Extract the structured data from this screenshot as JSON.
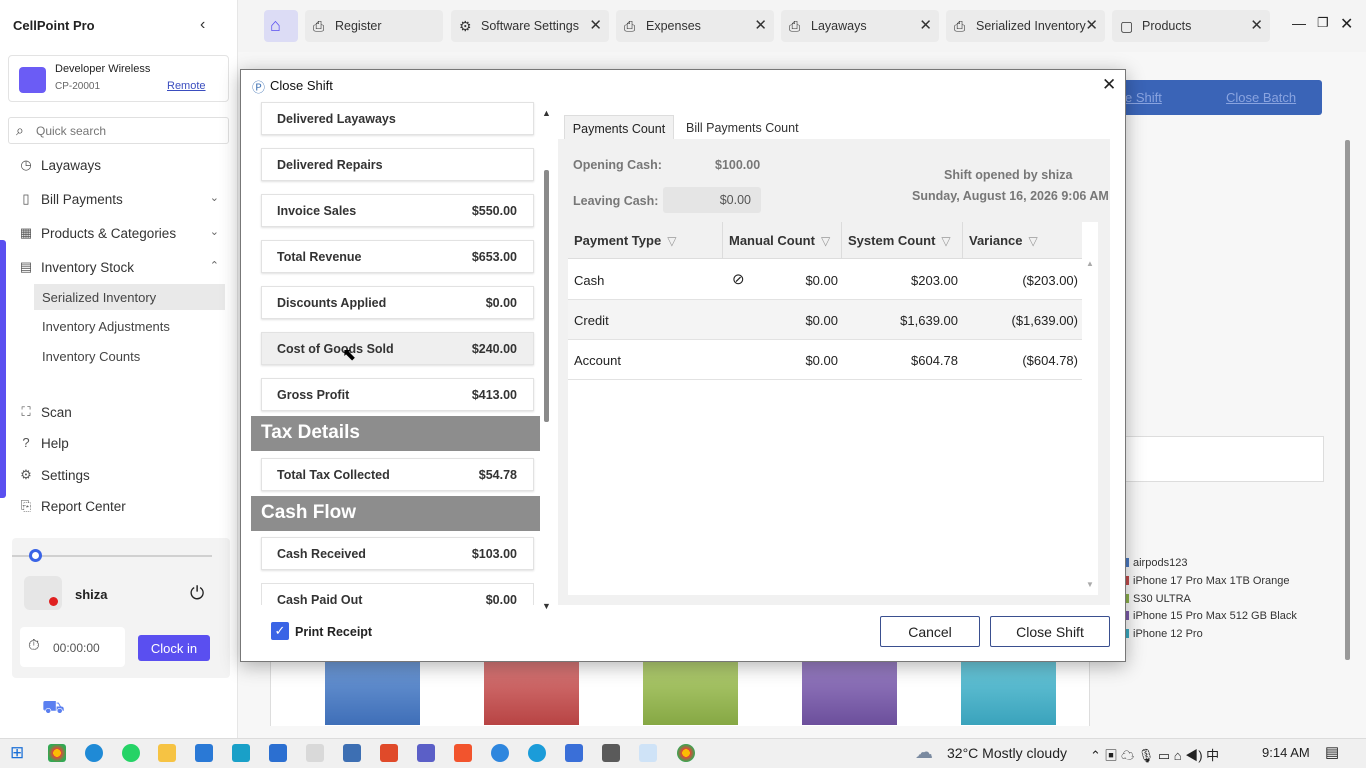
{
  "app": {
    "title": "CellPoint Pro"
  },
  "account": {
    "name": "Developer Wireless",
    "id": "CP-20001",
    "remote_label": "Remote"
  },
  "search": {
    "placeholder": "Quick search"
  },
  "sidebar": {
    "items": [
      {
        "label": "Layaways",
        "icon": "layaways-icon"
      },
      {
        "label": "Bill Payments",
        "icon": "bill-icon"
      },
      {
        "label": "Products & Categories",
        "icon": "products-icon"
      },
      {
        "label": "Inventory Stock",
        "icon": "inventory-icon"
      }
    ],
    "sub_items": [
      "Serialized Inventory",
      "Inventory Adjustments",
      "Inventory Counts"
    ],
    "bottom_items": [
      {
        "label": "Scan",
        "icon": "scan-icon"
      },
      {
        "label": "Help",
        "icon": "help-icon"
      },
      {
        "label": "Settings",
        "icon": "gear-icon"
      },
      {
        "label": "Report Center",
        "icon": "report-icon"
      }
    ]
  },
  "user": {
    "name": "shiza",
    "timer": "00:00:00",
    "clock_in_label": "Clock in"
  },
  "tabs": [
    {
      "label": "Register"
    },
    {
      "label": "Software Settings"
    },
    {
      "label": "Expenses"
    },
    {
      "label": "Layaways"
    },
    {
      "label": "Serialized Inventory"
    },
    {
      "label": "Products"
    }
  ],
  "background": {
    "links": [
      "e Shift",
      "Close Batch"
    ],
    "legend": [
      {
        "label": "airpods123",
        "color": "#4a78c0"
      },
      {
        "label": "iPhone 17 Pro Max 1TB Orange",
        "color": "#c04a4a"
      },
      {
        "label": "S30 ULTRA",
        "color": "#8ab04a"
      },
      {
        "label": "iPhone 15 Pro Max 512 GB Black",
        "color": "#7a5aa8"
      },
      {
        "label": "iPhone 12 Pro",
        "color": "#3aa8c0"
      }
    ]
  },
  "dialog": {
    "title": "Close Shift",
    "summary_rows": [
      {
        "label": "Delivered Layaways",
        "value": ""
      },
      {
        "label": "Delivered Repairs",
        "value": ""
      },
      {
        "label": "Invoice Sales",
        "value": "$550.00"
      },
      {
        "label": "Total Revenue",
        "value": "$653.00"
      },
      {
        "label": "Discounts Applied",
        "value": "$0.00"
      },
      {
        "label": "Cost of Goods Sold",
        "value": "$240.00"
      },
      {
        "label": "Gross Profit",
        "value": "$413.00"
      }
    ],
    "tax_section": "Tax Details",
    "tax_rows": [
      {
        "label": "Total Tax Collected",
        "value": "$54.78"
      }
    ],
    "cash_section": "Cash Flow",
    "cash_rows": [
      {
        "label": "Cash Received",
        "value": "$103.00"
      },
      {
        "label": "Cash Paid Out",
        "value": "$0.00"
      }
    ],
    "print_receipt": "Print Receipt",
    "cancel_label": "Cancel",
    "close_shift_label": "Close Shift",
    "panel_tabs": [
      "Payments Count",
      "Bill Payments Count"
    ],
    "opening_cash_label": "Opening Cash:",
    "opening_cash_value": "$100.00",
    "leaving_cash_label": "Leaving Cash:",
    "leaving_cash_value": "$0.00",
    "shift_opened_by": "Shift opened by shiza",
    "shift_date": "Sunday, August 16, 2026 9:06 AM",
    "grid": {
      "headers": [
        "Payment Type",
        "Manual Count",
        "System Count",
        "Variance"
      ],
      "rows": [
        {
          "type": "Cash",
          "manual": "$0.00",
          "system": "$203.00",
          "variance": "($203.00)"
        },
        {
          "type": "Credit",
          "manual": "$0.00",
          "system": "$1,639.00",
          "variance": "($1,639.00)"
        },
        {
          "type": "Account",
          "manual": "$0.00",
          "system": "$604.78",
          "variance": "($604.78)"
        }
      ]
    }
  },
  "taskbar": {
    "weather": "32°C  Mostly cloudy",
    "time": "9:14 AM"
  },
  "colors": {
    "accent": "#5a4ff0",
    "section_gray": "#8d8d8d",
    "checkbox": "#3a64e6"
  }
}
